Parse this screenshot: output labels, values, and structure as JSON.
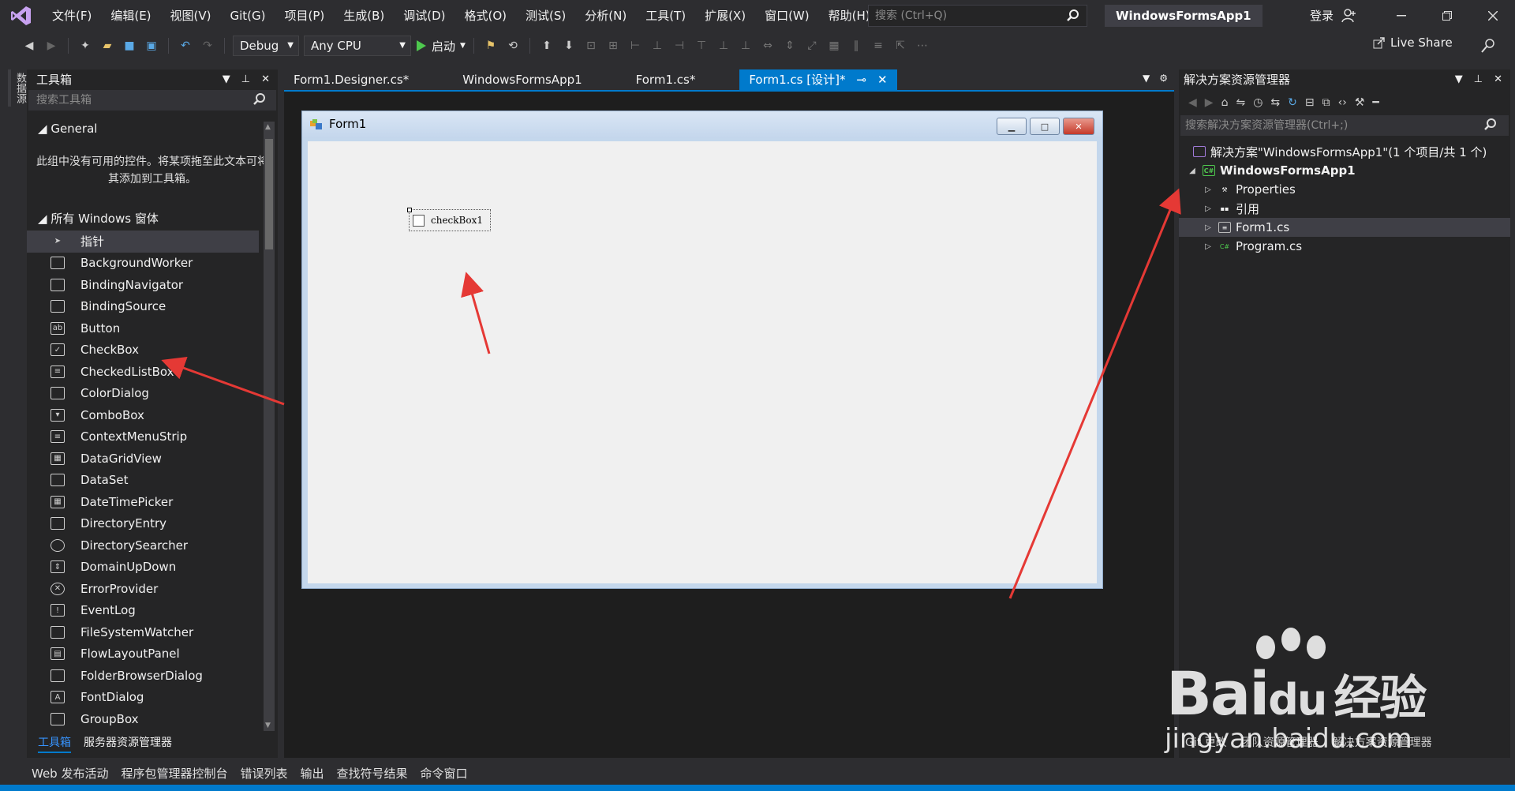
{
  "menu": {
    "items": [
      "文件(F)",
      "编辑(E)",
      "视图(V)",
      "Git(G)",
      "项目(P)",
      "生成(B)",
      "调试(D)",
      "格式(O)",
      "测试(S)",
      "分析(N)",
      "工具(T)",
      "扩展(X)",
      "窗口(W)",
      "帮助(H)"
    ],
    "search_placeholder": "搜索 (Ctrl+Q)",
    "solution_title": "WindowsFormsApp1",
    "login": "登录"
  },
  "toolbar": {
    "config": "Debug",
    "platform": "Any CPU",
    "start": "启动",
    "live_share": "Live Share"
  },
  "left_strip": {
    "vtab": "数据源"
  },
  "toolbox": {
    "title": "工具箱",
    "search_placeholder": "搜索工具箱",
    "general_group": "General",
    "empty_text": "此组中没有可用的控件。将某项拖至此文本可将其添加到工具箱。",
    "windows_group": "所有 Windows 窗体",
    "tools": [
      "指针",
      "BackgroundWorker",
      "BindingNavigator",
      "BindingSource",
      "Button",
      "CheckBox",
      "CheckedListBox",
      "ColorDialog",
      "ComboBox",
      "ContextMenuStrip",
      "DataGridView",
      "DataSet",
      "DateTimePicker",
      "DirectoryEntry",
      "DirectorySearcher",
      "DomainUpDown",
      "ErrorProvider",
      "EventLog",
      "FileSystemWatcher",
      "FlowLayoutPanel",
      "FolderBrowserDialog",
      "FontDialog",
      "GroupBox"
    ],
    "tabs": [
      "工具箱",
      "服务器资源管理器"
    ]
  },
  "editor": {
    "tabs": [
      "Form1.Designer.cs*",
      "WindowsFormsApp1",
      "Form1.cs*"
    ],
    "active_tab": "Form1.cs [设计]*",
    "form_title": "Form1",
    "checkbox_text": "checkBox1"
  },
  "solution_explorer": {
    "title": "解决方案资源管理器",
    "search_placeholder": "搜索解决方案资源管理器(Ctrl+;)",
    "tree": [
      {
        "label": "解决方案\"WindowsFormsApp1\"(1 个项目/共 1 个)",
        "level": 0
      },
      {
        "label": "WindowsFormsApp1",
        "level": 1
      },
      {
        "label": "Properties",
        "level": 2
      },
      {
        "label": "引用",
        "level": 2
      },
      {
        "label": "Form1.cs",
        "level": 2
      },
      {
        "label": "Program.cs",
        "level": 2
      }
    ],
    "tabs": [
      "Git 更改",
      "团队资源管理器",
      "解决方案资源管理器"
    ]
  },
  "bottom_tabs": [
    "Web 发布活动",
    "程序包管理器控制台",
    "错误列表",
    "输出",
    "查找符号结果",
    "命令窗口"
  ],
  "watermark": {
    "brand": "Bai",
    "brand2": "du",
    "cn": "经验",
    "url": "jingyan.baidu.com"
  },
  "colors": {
    "accent": "#007acc",
    "arrow": "#e53935",
    "bg": "#2d2d30"
  }
}
